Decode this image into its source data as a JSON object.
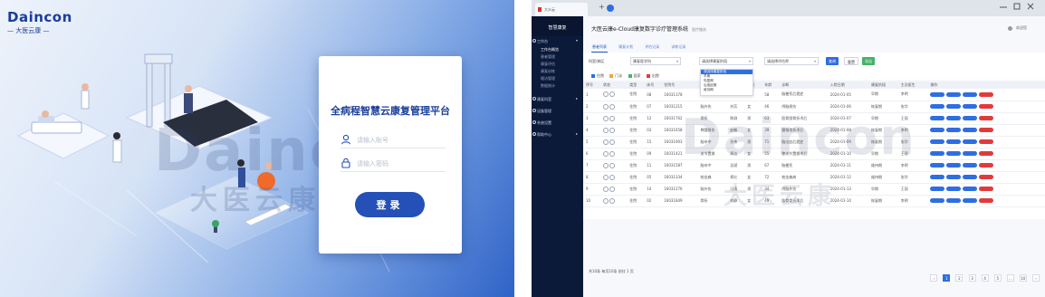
{
  "login": {
    "brand_name": "Daincon",
    "brand_sub": "— 大医云康 —",
    "watermark": "Daincon",
    "watermark_cn": "大医云康",
    "title": "全病程智慧云康复管理平台",
    "username_placeholder": "请输入账号",
    "password_placeholder": "请输入密码",
    "login_button": "登录",
    "colors": {
      "primary": "#2450b8",
      "title": "#1b3f9a"
    },
    "icons": [
      "user-icon",
      "lock-icon"
    ]
  },
  "admin": {
    "browser_tab": "大众云",
    "main_title": "大医云康e-Cloud康复数字诊疗管理系统",
    "main_title_sub": "医疗服务",
    "user": "欢迎您",
    "sidebar": {
      "header": "智慧康复",
      "sections": [
        {
          "label": "工作台",
          "items": [
            "工作台概览",
            "患者管理",
            "康复评估",
            "康复训练",
            "随访管理",
            "数据统计"
          ]
        },
        {
          "label": "康复科室"
        },
        {
          "label": "设备管理"
        },
        {
          "label": "系统设置"
        },
        {
          "label": "帮助中心"
        }
      ]
    },
    "tabs": [
      "患者列表",
      "康复计划",
      "评估记录",
      "训练记录"
    ],
    "filters": {
      "label": "科室/病区",
      "select1": "康复医学科",
      "select2": "请选择康复阶段",
      "select3": "请选择评估师",
      "search": "查询",
      "reset": "重置",
      "export": "导出"
    },
    "dropdown_options": [
      "请选择康复阶段",
      "早期",
      "恢复期",
      "后遗症期",
      "维持期"
    ],
    "legend": [
      "住院",
      "门诊",
      "居家",
      "出院"
    ],
    "legend_colors": [
      "#2f6ee0",
      "#f2a53a",
      "#44b36a",
      "#e23a3a"
    ],
    "table": {
      "headers": [
        "序号",
        "状态",
        "类型",
        "床号",
        "住院号",
        "诊断",
        "姓名",
        "性别",
        "年龄",
        "诊断",
        "入院日期",
        "康复阶段",
        "主治医生",
        "操作"
      ],
      "rows": [
        [
          "1",
          "住院",
          "08",
          "16031378",
          "脑卒中",
          "王强",
          "男",
          "58",
          "脑梗死后遗症",
          "2024-01-05",
          "早期",
          "李明"
        ],
        [
          "2",
          "住院",
          "07",
          "16031215",
          "脑外伤",
          "刘芳",
          "女",
          "46",
          "颅脑损伤",
          "2024-01-06",
          "恢复期",
          "张华"
        ],
        [
          "3",
          "住院",
          "12",
          "16031762",
          "骨折",
          "陈刚",
          "男",
          "63",
          "股骨颈骨折术后",
          "2024-01-07",
          "早期",
          "王丽"
        ],
        [
          "4",
          "住院",
          "03",
          "16031658",
          "脊髓损伤",
          "赵敏",
          "女",
          "39",
          "腰椎骨折术后",
          "2024-01-08",
          "恢复期",
          "李明"
        ],
        [
          "5",
          "住院",
          "15",
          "16031903",
          "脑卒中",
          "孙伟",
          "男",
          "71",
          "脑出血后遗症",
          "2024-01-09",
          "恢复期",
          "张华"
        ],
        [
          "6",
          "住院",
          "09",
          "16031421",
          "关节置换",
          "周洁",
          "女",
          "55",
          "膝关节置换术后",
          "2024-01-10",
          "早期",
          "王丽"
        ],
        [
          "7",
          "住院",
          "11",
          "16031587",
          "脑卒中",
          "吴斌",
          "男",
          "67",
          "脑梗死",
          "2024-01-11",
          "维持期",
          "李明"
        ],
        [
          "8",
          "住院",
          "05",
          "16031334",
          "帕金森",
          "郑红",
          "女",
          "72",
          "帕金森病",
          "2024-01-12",
          "维持期",
          "张华"
        ],
        [
          "9",
          "住院",
          "14",
          "16031276",
          "脑外伤",
          "冯涛",
          "男",
          "34",
          "颅脑外伤",
          "2024-01-13",
          "早期",
          "王丽"
        ],
        [
          "10",
          "住院",
          "02",
          "16031849",
          "骨折",
          "何静",
          "女",
          "49",
          "肱骨骨折术后",
          "2024-01-14",
          "恢复期",
          "李明"
        ]
      ]
    },
    "footer": "共10条 每页10条 前往 1 页",
    "pages": [
      "1",
      "2",
      "3",
      "4",
      "5",
      "…",
      "10"
    ],
    "watermark": "Daincon",
    "watermark_cn": "大医云康",
    "colors": {
      "sidebar": "#0c1a3a",
      "primary": "#2f6ee0",
      "danger": "#e23a3a"
    }
  }
}
